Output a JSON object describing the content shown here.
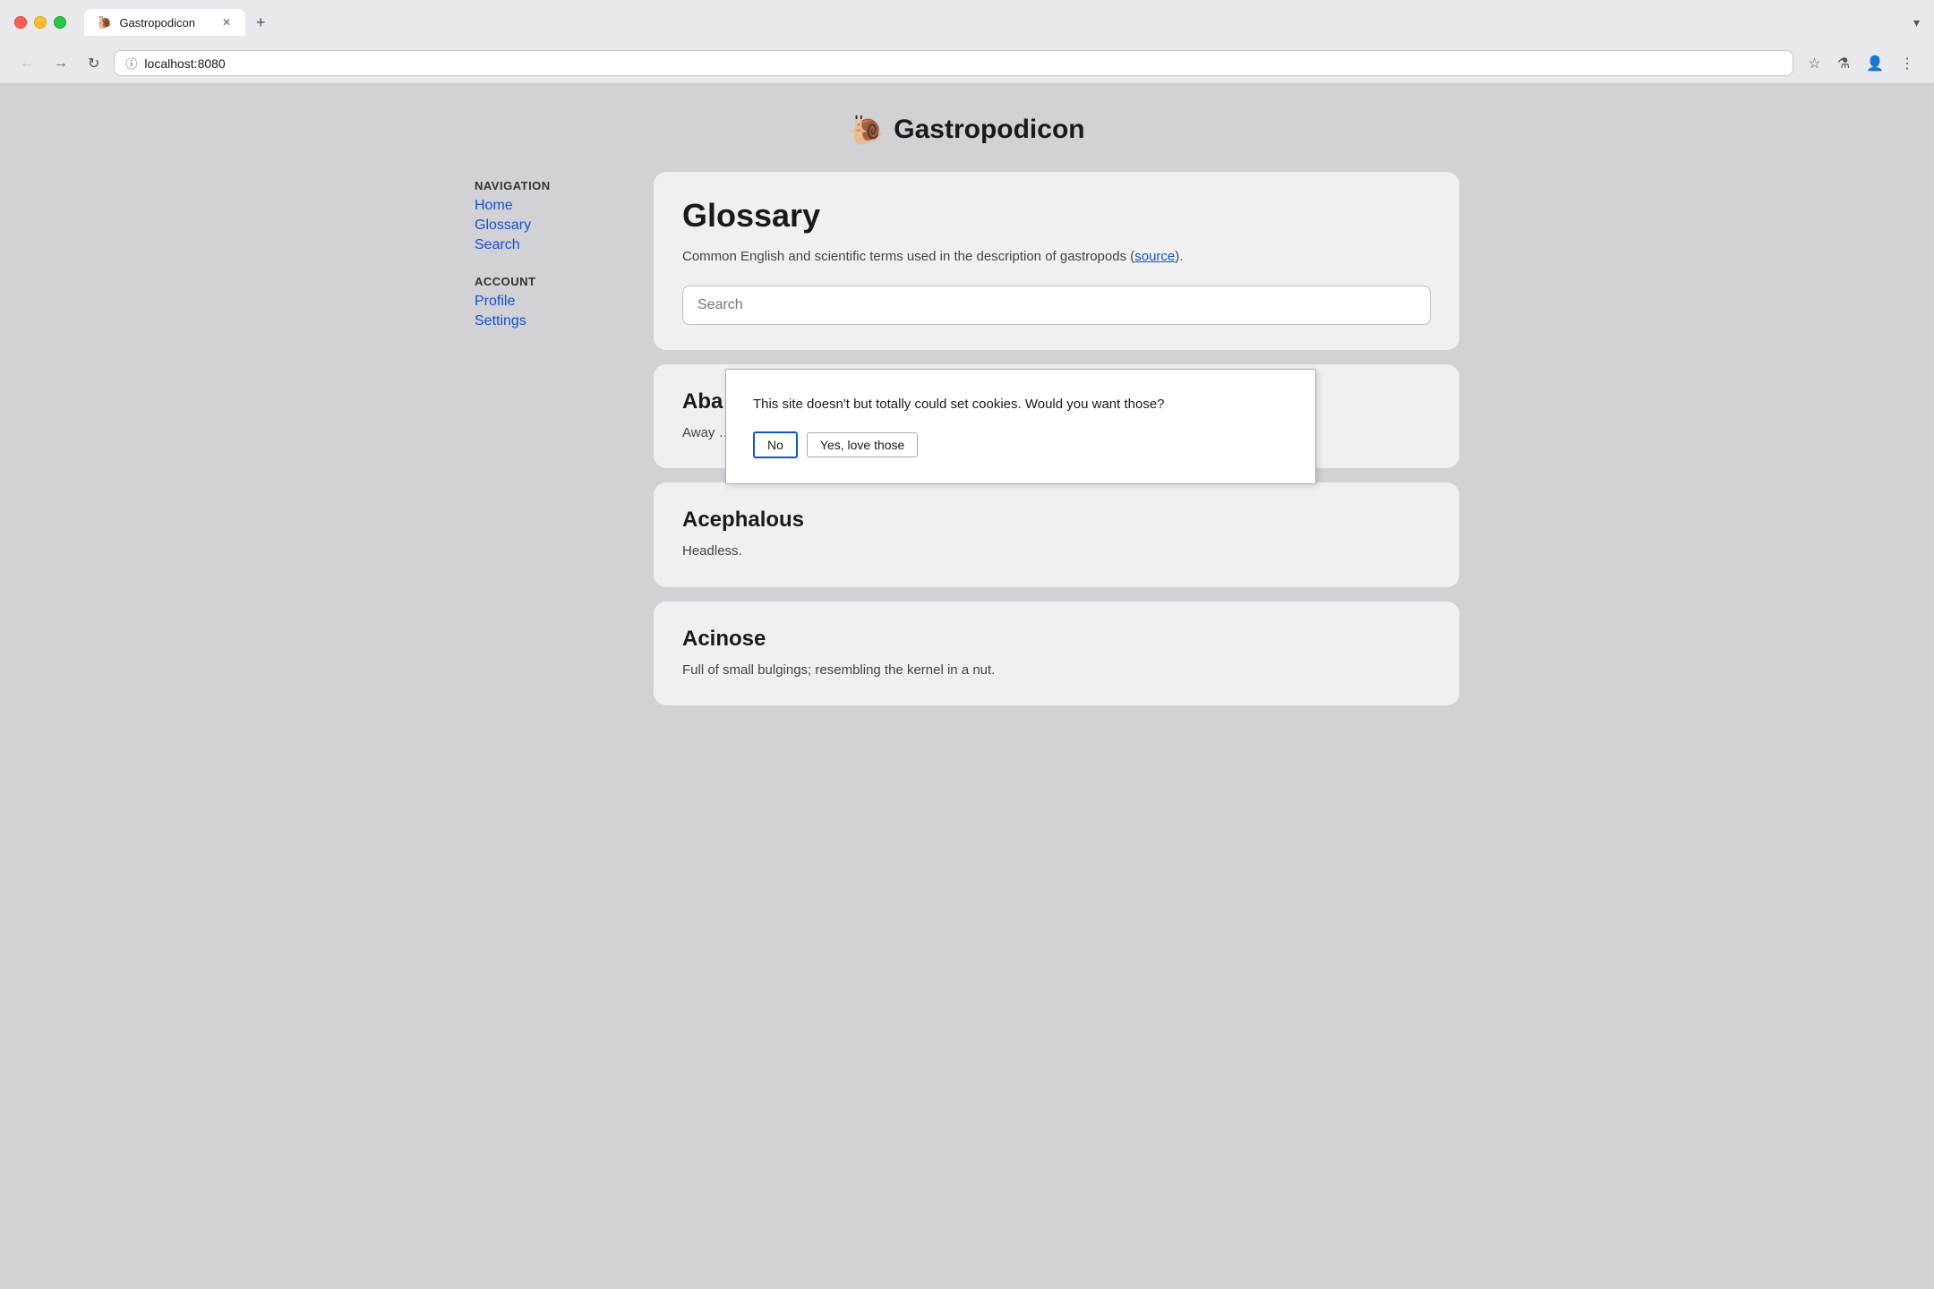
{
  "browser": {
    "tab_favicon": "🐌",
    "tab_title": "Gastropodicon",
    "tab_close": "✕",
    "tab_new": "+",
    "tab_dropdown": "▾",
    "back_icon": "←",
    "forward_icon": "→",
    "refresh_icon": "↻",
    "address": "localhost:8080",
    "address_info_icon": "ⓘ",
    "bookmark_icon": "☆",
    "experiment_icon": "⚗",
    "profile_icon": "👤",
    "menu_icon": "⋮"
  },
  "site": {
    "logo": "🐌",
    "title": "Gastropodicon"
  },
  "sidebar": {
    "nav_label": "NAVIGATION",
    "nav_links": [
      {
        "label": "Home",
        "href": "#"
      },
      {
        "label": "Glossary",
        "href": "#"
      },
      {
        "label": "Search",
        "href": "#"
      }
    ],
    "account_label": "ACCOUNT",
    "account_links": [
      {
        "label": "Profile",
        "href": "#"
      },
      {
        "label": "Settings",
        "href": "#"
      }
    ]
  },
  "main": {
    "glossary_title": "Glossary",
    "glossary_desc_before": "Common English and scientific terms used in the description of gastropods (",
    "glossary_desc_link": "source",
    "glossary_desc_after": ").",
    "search_placeholder": "Search",
    "terms": [
      {
        "title": "Aba…",
        "desc": "Away …"
      },
      {
        "title": "Acephalous",
        "desc": "Headless."
      },
      {
        "title": "Acinose",
        "desc": "Full of small bulgings; resembling the kernel in a nut."
      }
    ]
  },
  "cookie_dialog": {
    "message": "This site doesn't but totally could set cookies. Would you want those?",
    "btn_no": "No",
    "btn_yes": "Yes, love those"
  }
}
